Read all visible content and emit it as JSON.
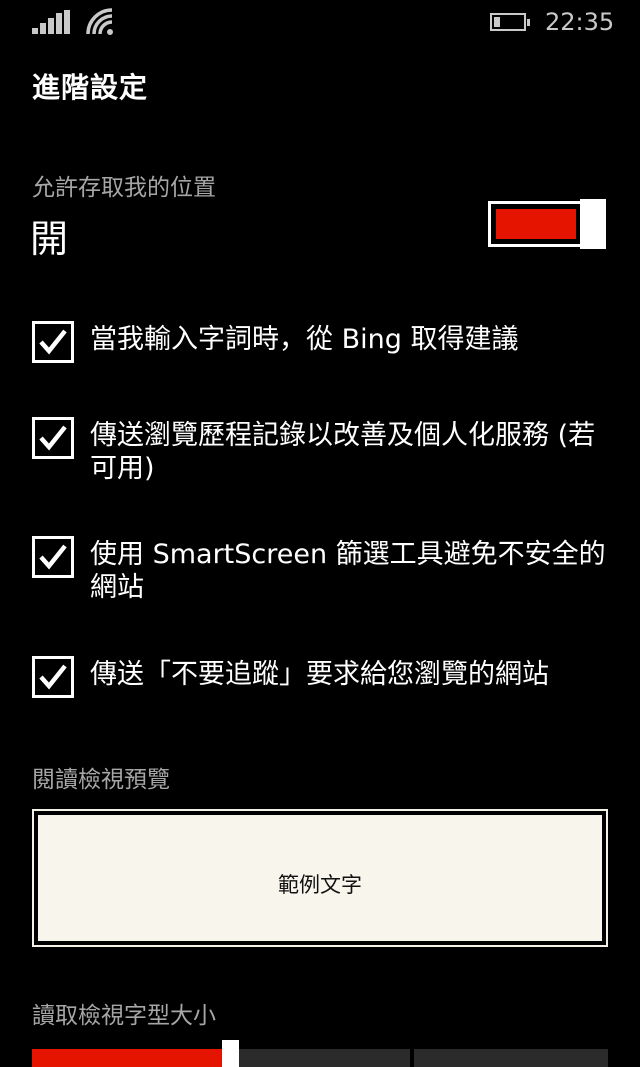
{
  "status_bar": {
    "time": "22:35",
    "signal_icon": "signal-strength-icon",
    "wifi_icon": "wifi-icon",
    "battery_icon": "battery-icon"
  },
  "page": {
    "title": "進階設定"
  },
  "location": {
    "label": "允許存取我的位置",
    "value": "開",
    "toggle_on": true,
    "accent_color": "#e51400"
  },
  "options": [
    {
      "label": "當我輸入字詞時，從 Bing 取得建議",
      "checked": true
    },
    {
      "label": "傳送瀏覽歷程記錄以改善及個人化服務 (若可用)",
      "checked": true
    },
    {
      "label": "使用 SmartScreen 篩選工具避免不安全的網站",
      "checked": true
    },
    {
      "label": "傳送「不要追蹤」要求給您瀏覽的網站",
      "checked": true
    }
  ],
  "reading_view": {
    "preview_label": "閱讀檢視預覽",
    "sample_text": "範例文字",
    "font_size_label": "讀取檢視字型大小",
    "font_size_level": 0.33
  }
}
